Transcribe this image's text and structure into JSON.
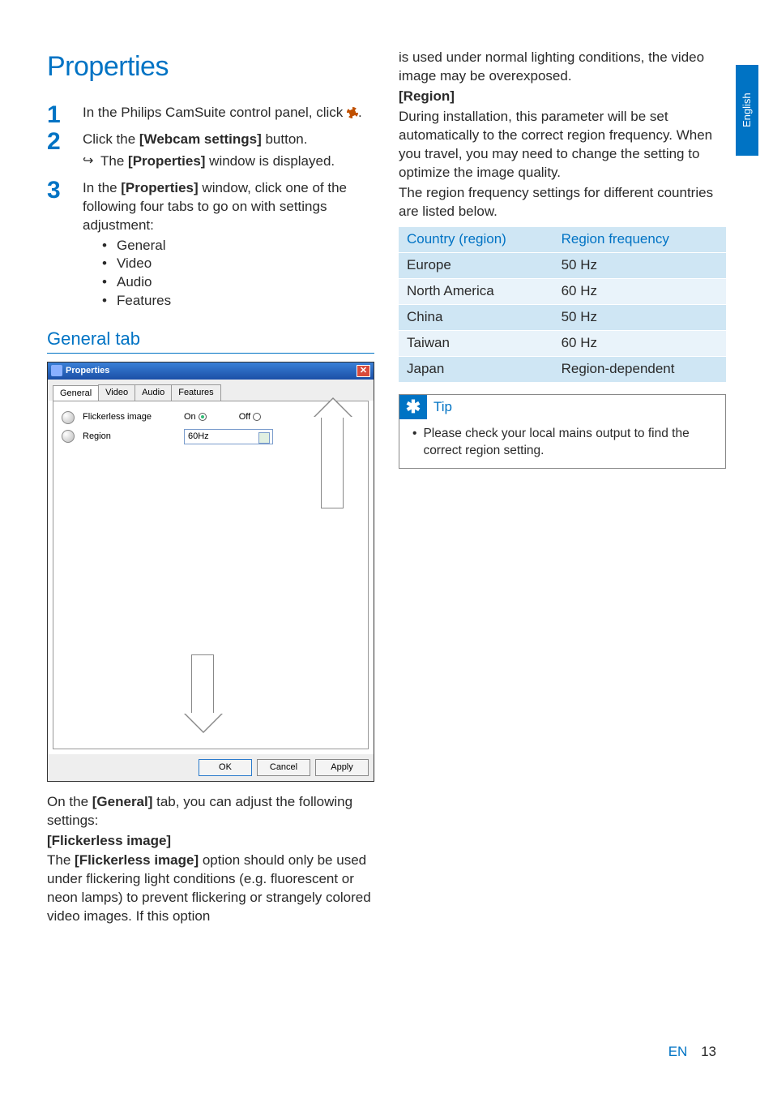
{
  "left": {
    "heading": "Properties",
    "steps": [
      {
        "text_pre": "In the Philips CamSuite control panel, click ",
        "text_post": "."
      },
      {
        "text_pre": "Click the ",
        "bold1": "[Webcam settings]",
        "text_mid": " button.",
        "sub_pre": "The ",
        "sub_bold": "[Properties]",
        "sub_post": " window is displayed."
      },
      {
        "text_pre": "In the ",
        "bold1": "[Properties]",
        "text_post": " window, click one of the following four tabs to go on with settings adjustment:",
        "bullets": [
          "General",
          "Video",
          "Audio",
          "Features"
        ]
      }
    ],
    "subheading": "General tab",
    "window": {
      "title": "Properties",
      "close": "✕",
      "tabs": [
        "General",
        "Video",
        "Audio",
        "Features"
      ],
      "row1_label": "Flickerless image",
      "row1_on": "On",
      "row1_off": "Off",
      "row2_label": "Region",
      "row2_value": "60Hz",
      "ok": "OK",
      "cancel": "Cancel",
      "apply": "Apply"
    },
    "below_window": {
      "p1_pre": "On the ",
      "p1_bold": "[General]",
      "p1_post": " tab, you can adjust the following settings:",
      "h_flicker": "[Flickerless image]",
      "p2_pre": "The ",
      "p2_bold": "[Flickerless image]",
      "p2_post": " option should only be used under flickering light conditions (e.g. fluorescent or neon lamps) to prevent flickering or strangely colored video images. If this option"
    }
  },
  "right": {
    "p_top": "is used under normal lighting conditions, the video image may be overexposed.",
    "h_region": "[Region]",
    "p_region1": "During installation, this parameter will be set automatically to the correct region frequency. When you travel, you may need to change the setting to optimize the image quality.",
    "p_region2": "The region frequency settings for different countries are listed below.",
    "table": {
      "head": [
        "Country (region)",
        "Region frequency"
      ],
      "rows": [
        [
          "Europe",
          "50 Hz"
        ],
        [
          "North America",
          "60 Hz"
        ],
        [
          "China",
          "50 Hz"
        ],
        [
          "Taiwan",
          "60 Hz"
        ],
        [
          "Japan",
          "Region-dependent"
        ]
      ]
    },
    "tip_label": "Tip",
    "tip_body": "Please check your local mains output to find the correct region setting."
  },
  "side_tab": "English",
  "footer_en": "EN",
  "footer_page": "13"
}
